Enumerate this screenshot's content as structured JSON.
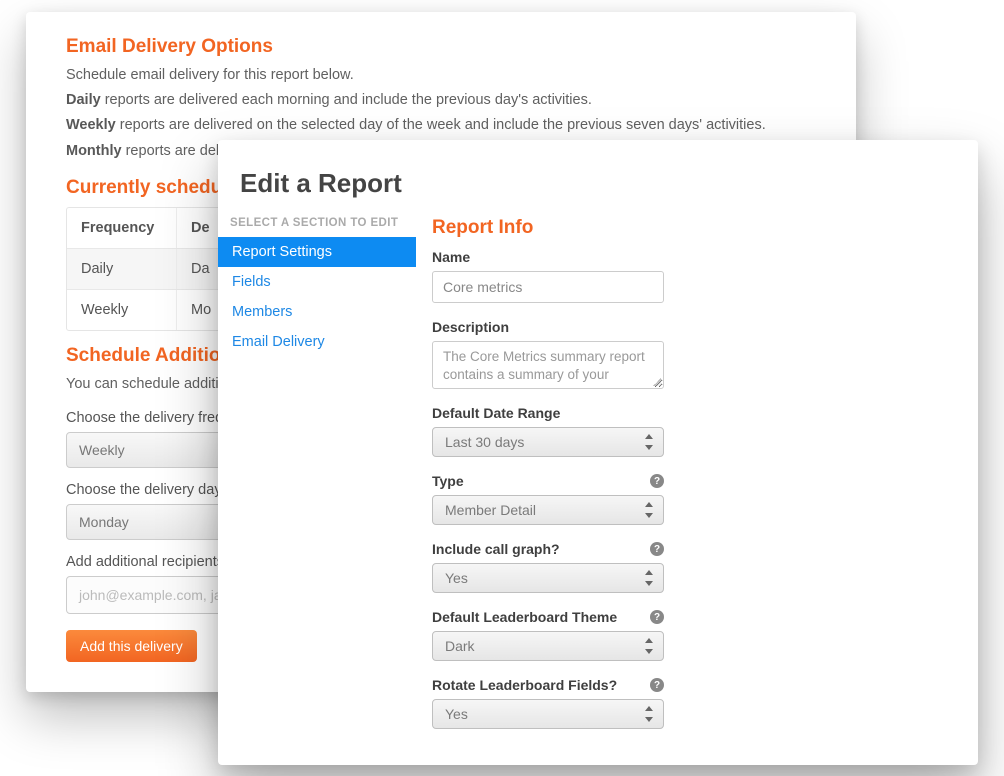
{
  "back": {
    "title_options": "Email Delivery Options",
    "intro": "Schedule email delivery for this report below.",
    "daily_bold": "Daily",
    "daily_rest": " reports are delivered each morning and include the previous day's activities.",
    "weekly_bold": "Weekly",
    "weekly_rest": " reports are delivered on the selected day of the week and include the previous seven days' activities.",
    "monthly_bold": "Monthly",
    "monthly_rest": " reports are del",
    "title_current": "Currently scheduled",
    "th_freq": "Frequency",
    "th_del": "De",
    "rows": [
      {
        "freq": "Daily",
        "del": "Da"
      },
      {
        "freq": "Weekly",
        "del": "Mo"
      }
    ],
    "title_additional": "Schedule Additional",
    "additional_intro": "You can schedule additi",
    "label_freq": "Choose the delivery freque",
    "sel_freq": "Weekly",
    "label_day": "Choose the delivery day:",
    "sel_day": "Monday",
    "label_recip": "Add additional recipients,",
    "input_recip_placeholder": "john@example.com, jane",
    "add_btn": "Add this delivery"
  },
  "modal": {
    "title": "Edit a Report",
    "sidebar_header": "SELECT A SECTION TO EDIT",
    "sidebar": [
      "Report Settings",
      "Fields",
      "Members",
      "Email Delivery"
    ],
    "section_title": "Report Info",
    "fields": {
      "name_label": "Name",
      "name_value": "Core metrics",
      "desc_label": "Description",
      "desc_value": "The Core Metrics summary report contains a summary of your",
      "daterange_label": "Default Date Range",
      "daterange_value": "Last 30 days",
      "type_label": "Type",
      "type_value": "Member Detail",
      "callgraph_label": "Include call graph?",
      "callgraph_value": "Yes",
      "theme_label": "Default Leaderboard Theme",
      "theme_value": "Dark",
      "rotate_label": "Rotate Leaderboard Fields?",
      "rotate_value": "Yes"
    }
  }
}
